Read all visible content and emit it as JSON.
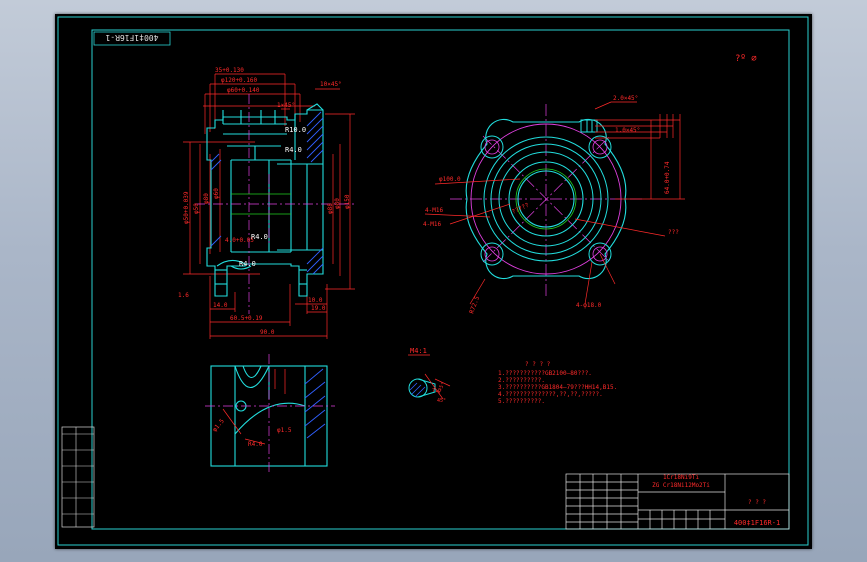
{
  "drawing": {
    "code_stamp": "400‡1F16R-1",
    "drawing_number": "400‡1F16R-1",
    "corner_marks": "?º ∅",
    "section_label": "M4:1",
    "notes_title": "? ? ? ?",
    "notes": [
      "1.???????????GB2100—80???.",
      "2.??????????.",
      "3.??????????GB1804—79???HH14,B15.",
      "4.??????????????,??,??,?????.",
      "5.??????????."
    ],
    "title_block": {
      "title_line1": "1Cr18Ni9Ti",
      "title_line2": "ZG Cr18Ni12Mo2Ti",
      "company": "? ? ?"
    },
    "dimensions": {
      "top": [
        "35+0.130",
        "φ120+0.160",
        "φ60+0.140",
        "10×45°",
        "1×45°",
        "R10.0",
        "R4.0"
      ],
      "left": [
        "φ50+0.039",
        "φ50",
        "φ80",
        "φ60",
        "4.0+0.05"
      ],
      "right": [
        "φ88",
        "φ80",
        "φ150",
        "R4.0",
        "R4.0"
      ],
      "bottom": [
        "1.6",
        "14.0",
        "60.5+0.19",
        "90.0",
        "10.0",
        "19.0"
      ],
      "flange": [
        "2.0×45°",
        "1.0×45°",
        "64.0+0.74",
        "φ100.0",
        "R72.5",
        "4-M16",
        "4-φ18.0",
        "???",
        "?????"
      ],
      "lower": [
        "φ1.5",
        "R4.0",
        "φ1.5"
      ],
      "detail": [
        "7.0",
        "3.5°",
        "45°"
      ]
    },
    "colors": {
      "frame": "#2ad1d1",
      "red": "#ff2a2a",
      "cyan": "#22dddd",
      "blue": "#3060ff",
      "magenta": "#e040e0",
      "green": "#21d121",
      "white": "#ffffff"
    }
  }
}
